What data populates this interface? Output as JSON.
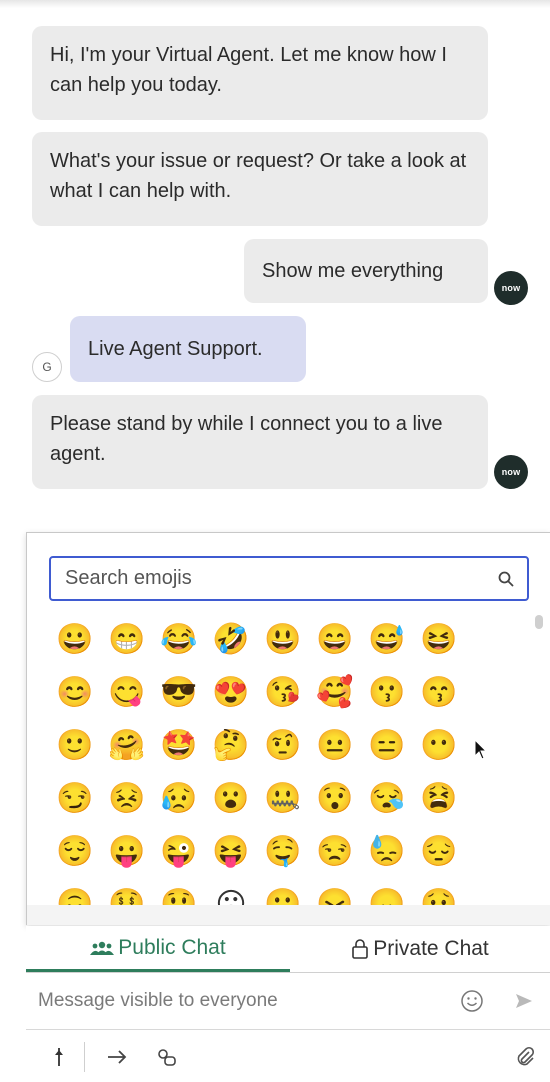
{
  "messages": [
    {
      "id": "b1",
      "sender": "agent",
      "text": "Hi, I'm your Virtual Agent. Let me know how I can help you today."
    },
    {
      "id": "b2",
      "sender": "agent",
      "text": "What's your issue or request? Or take a look at what I can help with."
    },
    {
      "id": "b3",
      "sender": "agent",
      "text": "Show me everything"
    },
    {
      "id": "b4",
      "sender": "user",
      "text": "Live Agent Support."
    },
    {
      "id": "b5",
      "sender": "agent",
      "text": "Please stand by while I connect you to a live agent."
    }
  ],
  "avatars": {
    "now": "now",
    "user_initial": "G"
  },
  "emoji_picker": {
    "search_placeholder": "Search emojis",
    "rows": [
      [
        "😀",
        "😁",
        "😂",
        "🤣",
        "😃",
        "😄",
        "😅",
        "😆"
      ],
      [
        "😊",
        "😋",
        "😎",
        "😍",
        "😘",
        "🥰",
        "😗",
        "😙"
      ],
      [
        "🙂",
        "🤗",
        "🤩",
        "🤔",
        "🤨",
        "😐",
        "😑",
        "😶"
      ],
      [
        "😏",
        "😣",
        "😥",
        "😮",
        "🤐",
        "😯",
        "😪",
        "😫"
      ],
      [
        "😌",
        "😛",
        "😜",
        "😝",
        "🤤",
        "😒",
        "😓",
        "😔"
      ],
      [
        "🙃",
        "🤑",
        "😲",
        "☹",
        "🙁",
        "😖",
        "😞",
        "😟"
      ]
    ]
  },
  "tabs": {
    "public": "Public Chat",
    "private": "Private Chat"
  },
  "composer": {
    "placeholder": "Message visible to everyone"
  },
  "icons": [
    "search-icon",
    "smiley-icon",
    "send-icon",
    "group-icon",
    "lock-icon",
    "pin-icon",
    "arrow-right-icon",
    "link-icon",
    "paperclip-icon"
  ],
  "colors": {
    "accent": "#2e7d5c",
    "search_border": "#3f5bd1",
    "user_bubble": "#d9dcf2",
    "agent_bubble": "#ebebeb"
  }
}
